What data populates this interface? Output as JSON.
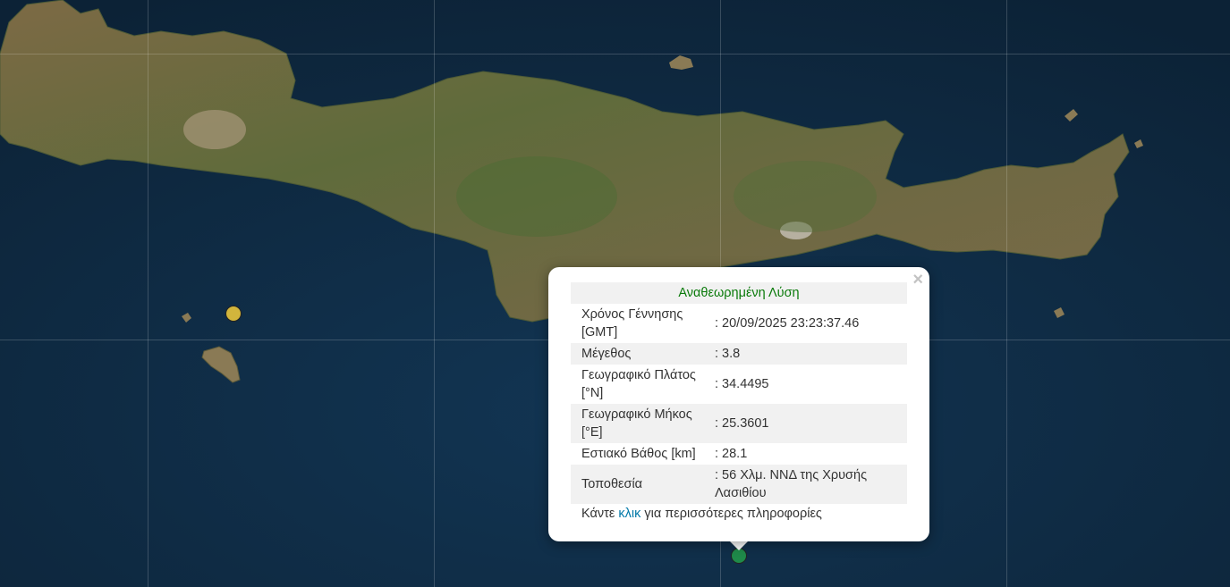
{
  "map": {
    "colors": {
      "sea": "#0f2c44",
      "land": "#6b6a44",
      "marker_west": "#d2b53c",
      "marker_event": "#1f8a4a"
    }
  },
  "markers": [
    {
      "name": "earthquake-marker-west",
      "color": "#d2b53c"
    },
    {
      "name": "earthquake-marker-selected",
      "color": "#1f8a4a"
    }
  ],
  "popup": {
    "close_icon": "×",
    "title": "Αναθεωρημένη Λύση",
    "rows": [
      {
        "label": "Χρόνος Γέννησης [GMT]",
        "value": ": 20/09/2025 23:23:37.46"
      },
      {
        "label": "Μέγεθος",
        "value": ": 3.8"
      },
      {
        "label": "Γεωγραφικό Πλάτος [°N]",
        "value": ": 34.4495"
      },
      {
        "label": "Γεωγραφικό Μήκος [°E]",
        "value": ": 25.3601"
      },
      {
        "label": "Εστιακό Βάθος [km]",
        "value": ": 28.1"
      },
      {
        "label": "Τοποθεσία",
        "value": ": 56 Χλμ. ΝΝΔ της Χρυσής Λασιθίου"
      }
    ],
    "more_prefix": "Κάντε ",
    "more_link": "κλικ",
    "more_suffix": " για περισσότερες πληροφορίες"
  }
}
